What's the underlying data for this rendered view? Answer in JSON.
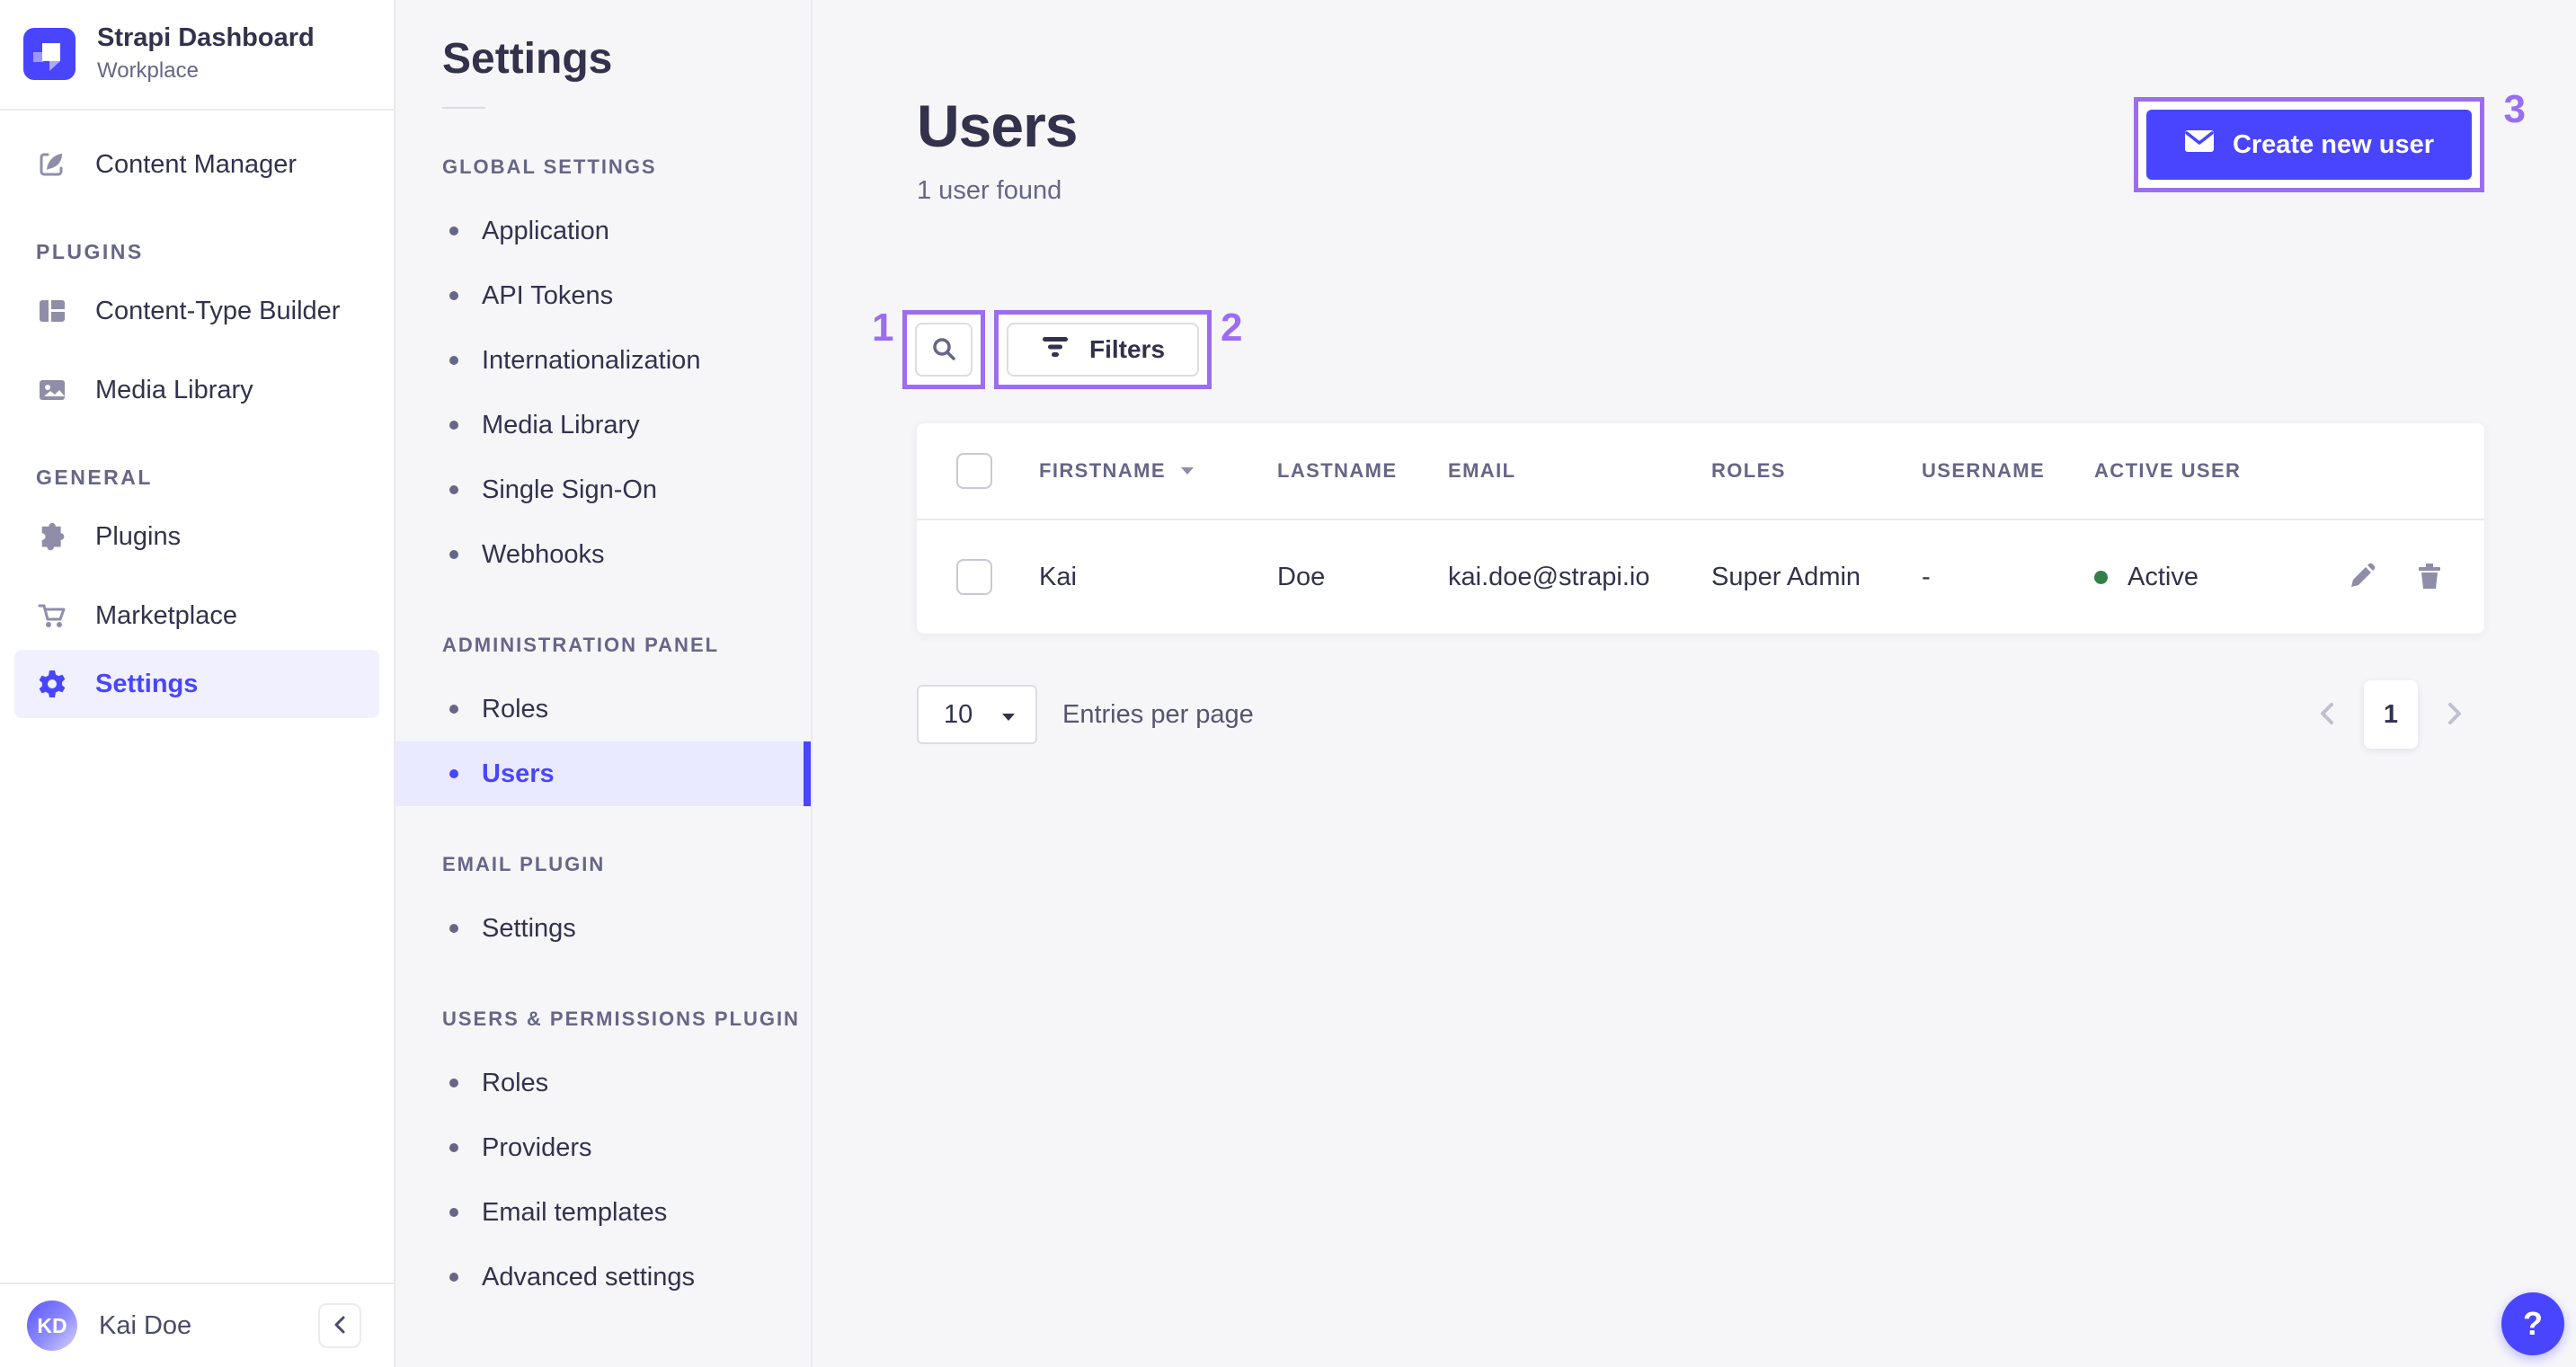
{
  "brand": {
    "title": "Strapi Dashboard",
    "subtitle": "Workplace"
  },
  "nav": {
    "primary": [
      {
        "label": "Content Manager",
        "icon": "pen-square-icon"
      }
    ],
    "sections": [
      {
        "title": "PLUGINS",
        "items": [
          {
            "label": "Content-Type Builder",
            "icon": "layout-icon"
          },
          {
            "label": "Media Library",
            "icon": "picture-icon"
          }
        ]
      },
      {
        "title": "GENERAL",
        "items": [
          {
            "label": "Plugins",
            "icon": "puzzle-icon"
          },
          {
            "label": "Marketplace",
            "icon": "cart-icon"
          },
          {
            "label": "Settings",
            "icon": "gear-icon",
            "active": true
          }
        ]
      }
    ],
    "user": {
      "initials": "KD",
      "name": "Kai Doe"
    }
  },
  "subnav": {
    "title": "Settings",
    "sections": [
      {
        "title": "GLOBAL SETTINGS",
        "items": [
          {
            "label": "Application"
          },
          {
            "label": "API Tokens"
          },
          {
            "label": "Internationalization"
          },
          {
            "label": "Media Library"
          },
          {
            "label": "Single Sign-On"
          },
          {
            "label": "Webhooks"
          }
        ]
      },
      {
        "title": "ADMINISTRATION PANEL",
        "items": [
          {
            "label": "Roles"
          },
          {
            "label": "Users",
            "active": true
          }
        ]
      },
      {
        "title": "EMAIL PLUGIN",
        "items": [
          {
            "label": "Settings"
          }
        ]
      },
      {
        "title": "USERS & PERMISSIONS PLUGIN",
        "items": [
          {
            "label": "Roles"
          },
          {
            "label": "Providers"
          },
          {
            "label": "Email templates"
          },
          {
            "label": "Advanced settings"
          }
        ]
      }
    ]
  },
  "main": {
    "title": "Users",
    "subtitle": "1 user found",
    "create_button_label": "Create new user",
    "filters_label": "Filters",
    "table": {
      "headers": [
        "FIRSTNAME",
        "LASTNAME",
        "EMAIL",
        "ROLES",
        "USERNAME",
        "ACTIVE USER"
      ],
      "rows": [
        {
          "firstname": "Kai",
          "lastname": "Doe",
          "email": "kai.doe@strapi.io",
          "roles": "Super Admin",
          "username": "-",
          "active_label": "Active"
        }
      ]
    },
    "pagination": {
      "page_size": "10",
      "entries_label": "Entries per page",
      "page": "1"
    }
  },
  "annotations": {
    "one": "1",
    "two": "2",
    "three": "3"
  },
  "help_label": "?",
  "colors": {
    "accent": "#4945ff",
    "annotation": "#9b6df0",
    "success_dot": "#328048",
    "text": "#32324d",
    "muted": "#666687",
    "content_background": "#f6f6f9"
  }
}
